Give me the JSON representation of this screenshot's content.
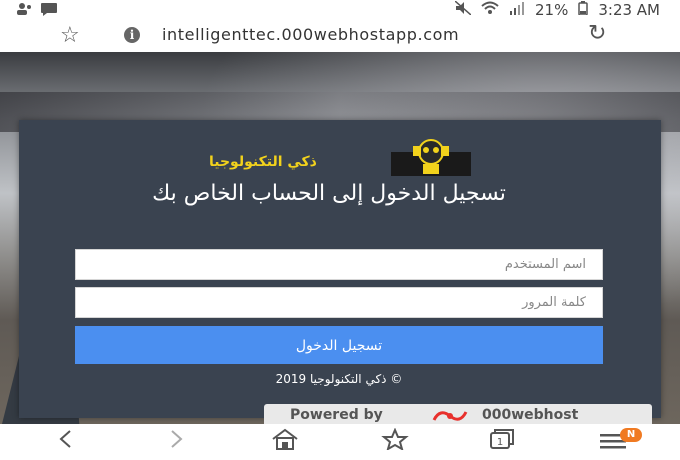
{
  "status_bar": {
    "battery": "21%",
    "time": "3:23 AM"
  },
  "url_bar": {
    "url": "intelligenttec.000webhostapp.com"
  },
  "login_card": {
    "logo_text": "ذكي التكنولوجيا",
    "title": "تسجيل الدخول إلى الحساب الخاص بك",
    "username_placeholder": "اسم المستخدم",
    "password_placeholder": "كلمة المرور",
    "login_button": "تسجيل الدخول",
    "footer": "ذكي التكنولوجيا 2019 ©"
  },
  "powered_banner": {
    "label": "Powered by",
    "brand": "000webhost"
  },
  "nav_bar": {
    "tabs_count": "1",
    "menu_badge": "N"
  },
  "colors": {
    "card_bg": "#3a4350",
    "button_bg": "#4b8ff0",
    "logo_yellow": "#f2d21c",
    "badge_orange": "#f07a22"
  }
}
